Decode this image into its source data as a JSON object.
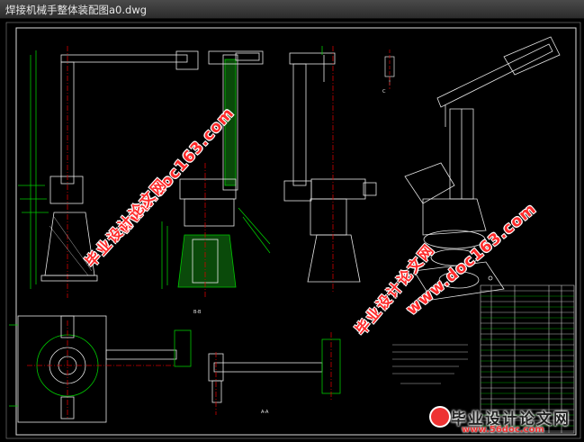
{
  "window": {
    "title": "焊接机械手整体装配图a0.dwg"
  },
  "watermarks": {
    "url_1": "www.doc163.com",
    "cn_1": "毕业设计论文网",
    "url_2": "www.doc163.com",
    "cn_2": "毕业设计论文网"
  },
  "footer": {
    "brand_cn": "毕业设计论文网",
    "brand_url": "www.56doc.com"
  },
  "colors": {
    "line_green": "#00c800",
    "line_white": "#e6e6e6",
    "line_yellow": "#e6e600",
    "line_cyan": "#00c8c8",
    "line_red": "#d00000",
    "frame_white": "#dcdcdc"
  }
}
